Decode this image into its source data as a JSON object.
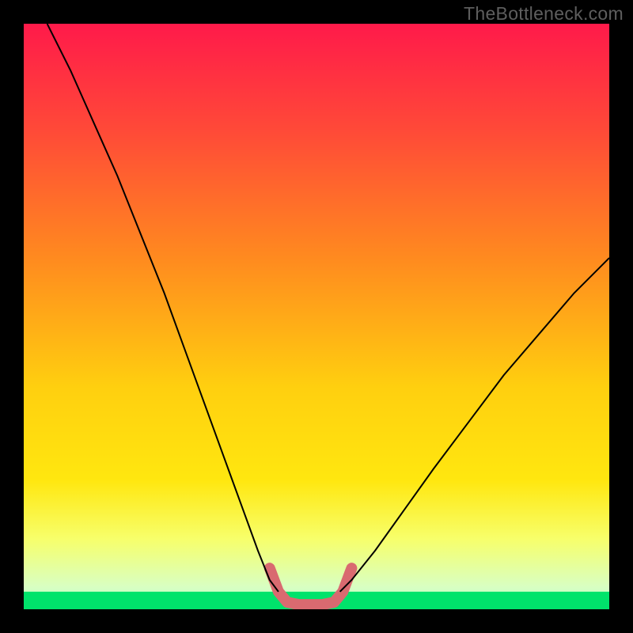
{
  "watermark": "TheBottleneck.com",
  "chart_data": {
    "type": "line",
    "title": "",
    "xlabel": "",
    "ylabel": "",
    "xlim": [
      0,
      100
    ],
    "ylim": [
      0,
      100
    ],
    "grid": false,
    "legend": false,
    "background_gradient": {
      "top": "#ff1a4a",
      "mid1": "#ff8a1f",
      "mid2": "#ffe70f",
      "mid3": "#f7ff6b",
      "bottom_band": "#00e36b"
    },
    "green_band_y_range": [
      0,
      3
    ],
    "series": [
      {
        "name": "left-curve",
        "color": "#000000",
        "stroke_width": 2,
        "x": [
          4,
          8,
          12,
          16,
          20,
          24,
          28,
          32,
          36,
          40,
          42,
          43.5
        ],
        "y": [
          100,
          92,
          83,
          74,
          64,
          54,
          43,
          32,
          21,
          10,
          5,
          3
        ]
      },
      {
        "name": "right-curve",
        "color": "#000000",
        "stroke_width": 2,
        "x": [
          54,
          56,
          60,
          65,
          70,
          76,
          82,
          88,
          94,
          100
        ],
        "y": [
          3,
          5,
          10,
          17,
          24,
          32,
          40,
          47,
          54,
          60
        ]
      },
      {
        "name": "valley-highlight",
        "color": "#d96a70",
        "stroke_width": 14,
        "stroke_linecap": "round",
        "x": [
          42,
          43.5,
          45,
          47,
          49,
          51,
          53,
          54.5,
          56
        ],
        "y": [
          7,
          3,
          1.2,
          0.8,
          0.8,
          0.8,
          1.2,
          3,
          7
        ]
      }
    ]
  }
}
